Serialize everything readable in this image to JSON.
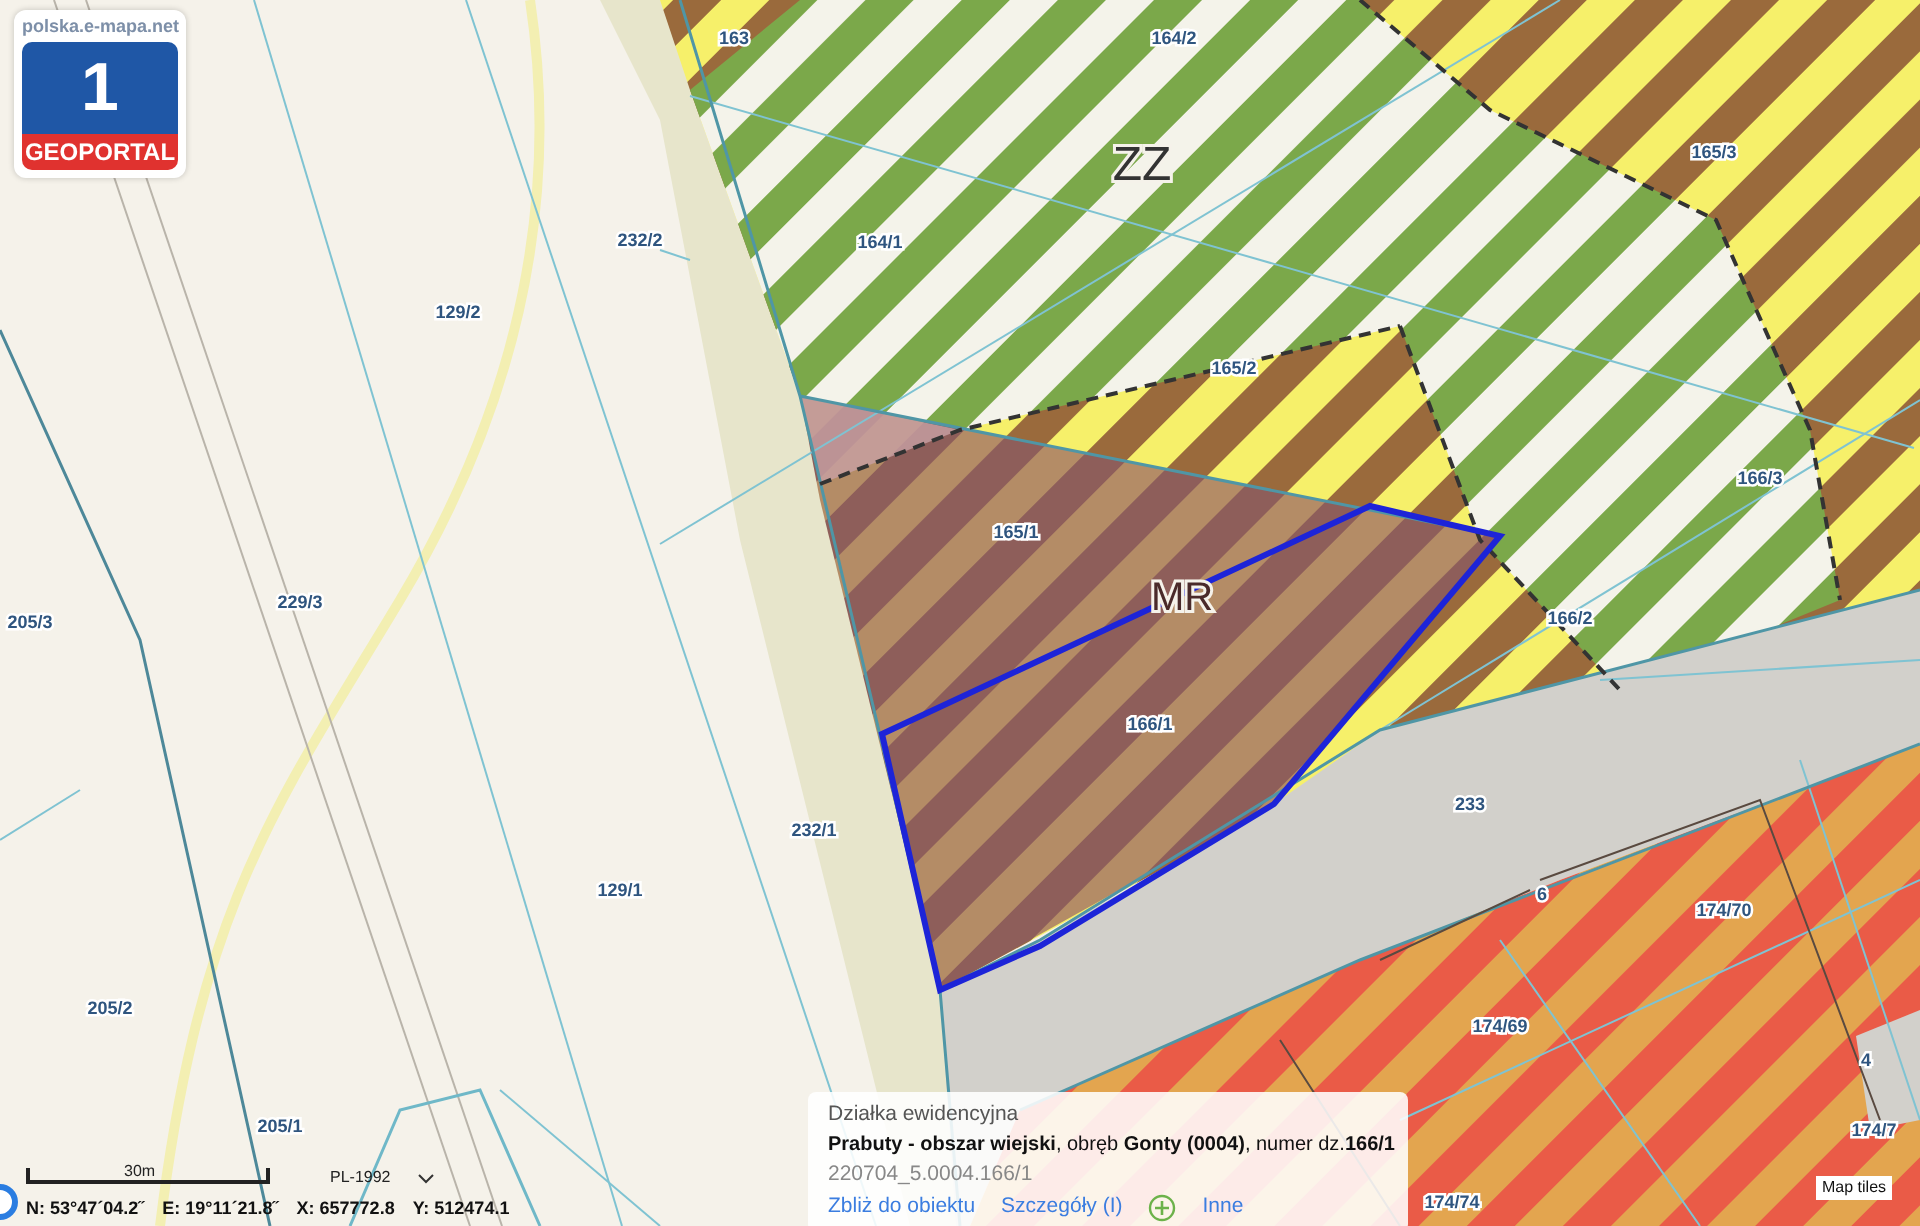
{
  "logo": {
    "site": "polska.e-mapa.net",
    "number": "1",
    "name": "GEOPORTAL"
  },
  "zones": [
    {
      "label": "ZZ"
    },
    {
      "label": "MR"
    }
  ],
  "parcels": [
    "163",
    "164/2",
    "165/3",
    "164/1",
    "232/2",
    "129/2",
    "165/2",
    "166/3",
    "165/1",
    "166/2",
    "229/3",
    "205/3",
    "166/1",
    "233",
    "232/1",
    "129/1",
    "174/70",
    "205/2",
    "174/69",
    "205/1",
    "174/74",
    "174/7",
    "6",
    "4"
  ],
  "info_popup": {
    "title": "Działka ewidencyjna",
    "description": "**Prabuty - obszar wiejski**, obręb **Gonty (0004)**, numer dz.**166/1**",
    "identifier": "220704_5.0004.166/1",
    "links": [
      {
        "label": "Zbliż do obiektu",
        "kind": "link"
      },
      {
        "label": "Szczegóły (I)",
        "kind": "link"
      },
      {
        "label": "Inne",
        "kind": "plus"
      }
    ]
  },
  "scale": {
    "label": "30m"
  },
  "projection": {
    "value": "PL-1992"
  },
  "coordinates": [
    {
      "text": "N: 53°47´04.2˝"
    },
    {
      "text": "E: 19°11´21.8˝"
    },
    {
      "text": "X: 657772.8"
    },
    {
      "text": "Y: 512474.1"
    }
  ],
  "attribution": "Map tiles"
}
